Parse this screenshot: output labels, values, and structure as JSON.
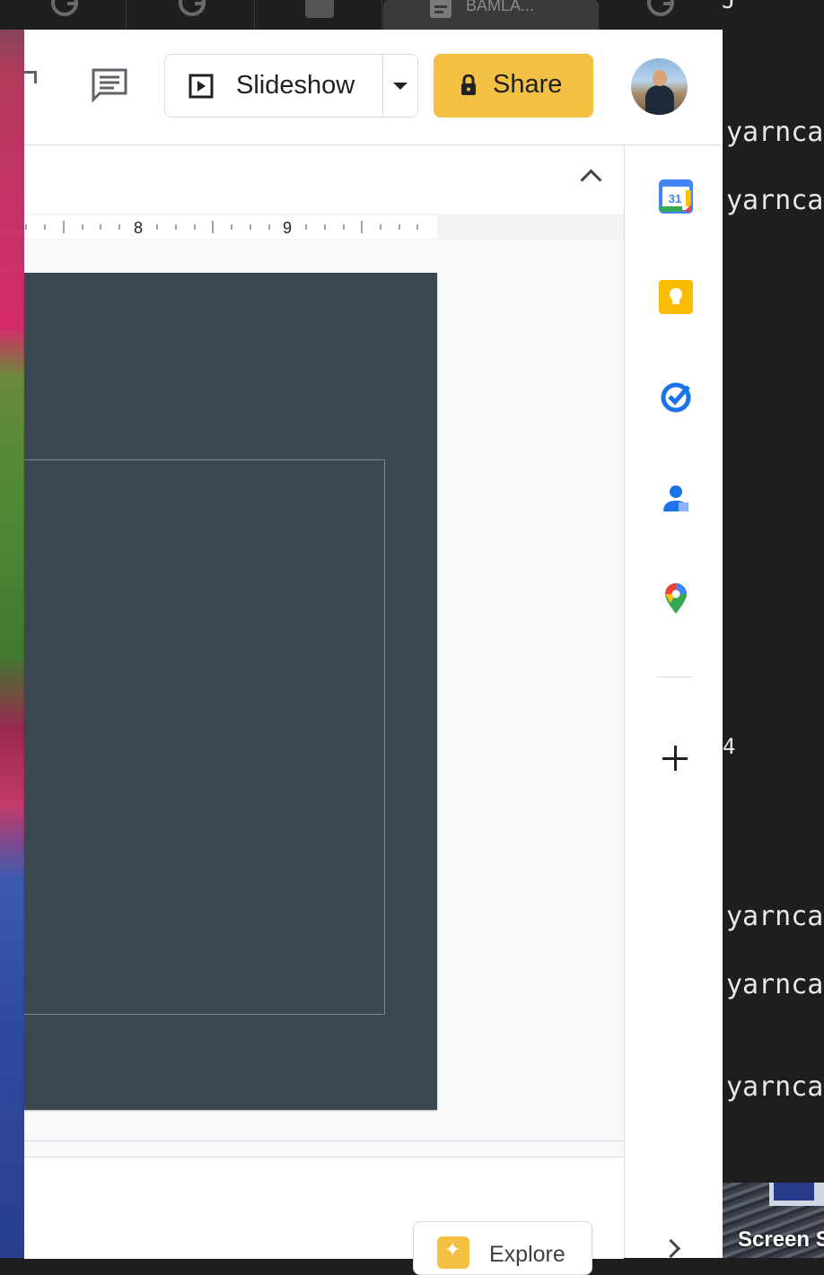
{
  "tabs": [
    {
      "label": "",
      "icon": "google-g-icon"
    },
    {
      "label": "",
      "icon": "google-g-icon"
    },
    {
      "label": "",
      "icon": "tab-favicon"
    },
    {
      "label": "BAMLA...",
      "icon": "docs-icon",
      "active": true
    },
    {
      "label": "",
      "icon": "google-g-icon"
    }
  ],
  "toolbar": {
    "slideshow_label": "Slideshow",
    "share_label": "Share"
  },
  "ruler": {
    "marks": [
      "8",
      "9"
    ]
  },
  "explore": {
    "label": "Explore"
  },
  "side_panel": {
    "items": [
      "calendar-icon",
      "keep-icon",
      "tasks-icon",
      "contacts-icon",
      "maps-icon"
    ],
    "calendar_day": "31"
  },
  "terminal": {
    "lines": [
      "yarncat",
      "yarncat",
      "4",
      "yarncat",
      "yarncat",
      "yarncat"
    ],
    "top_char": "J",
    "thumbnail_label": "Screen S"
  },
  "colors": {
    "share_yellow": "#f2c043",
    "slide_bg": "#3b4750",
    "panel_bg": "#f8f9fa"
  }
}
